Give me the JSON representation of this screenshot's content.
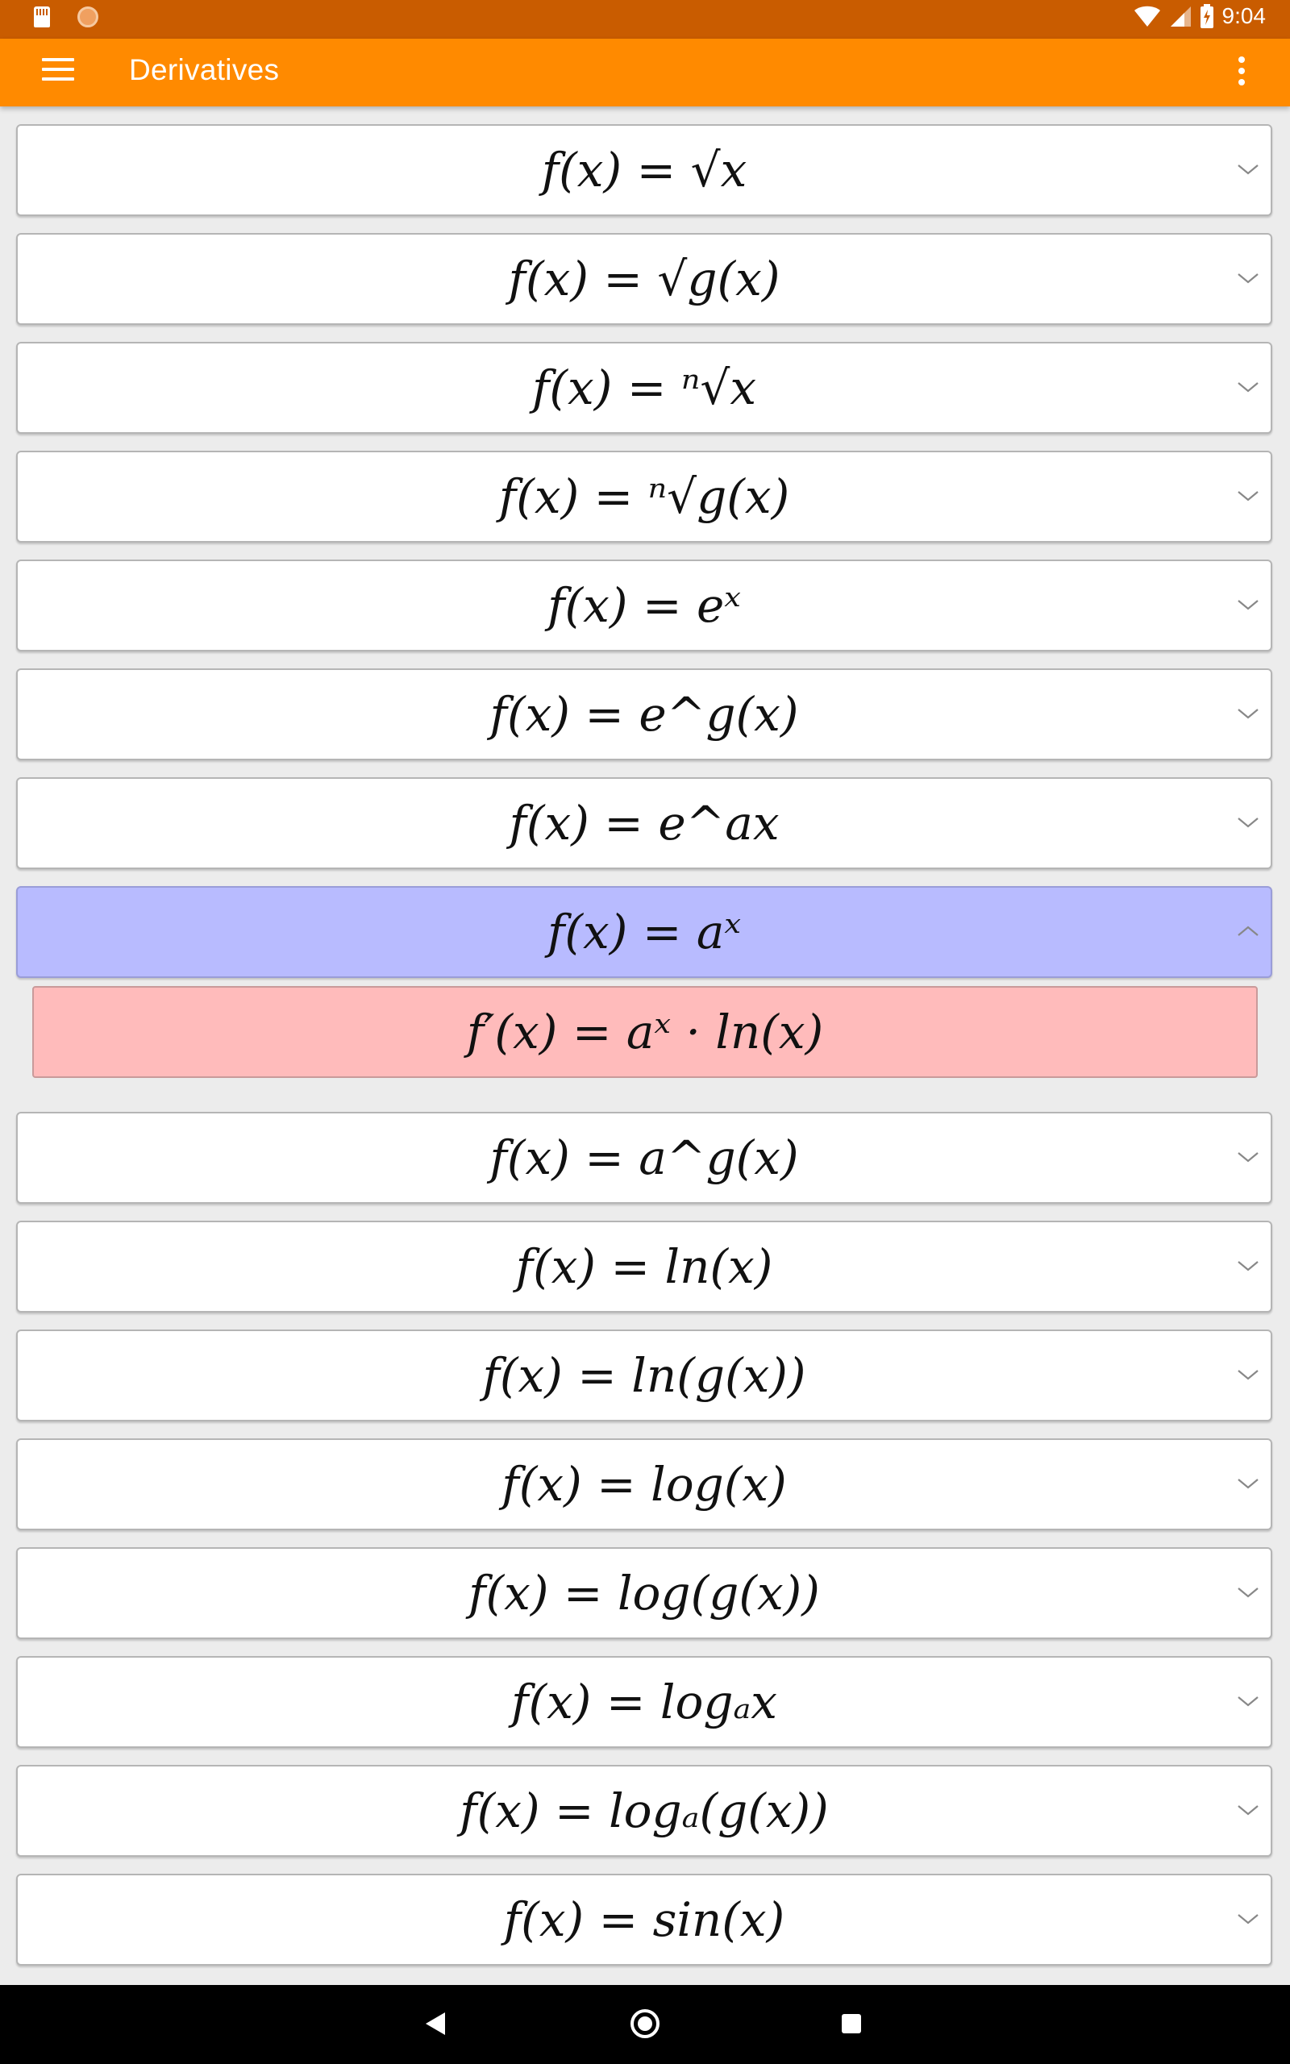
{
  "status_bar": {
    "time": "9:04",
    "icons": [
      "sd-card-icon",
      "record-icon",
      "wifi-icon",
      "signal-icon",
      "battery-charging-icon"
    ]
  },
  "app_bar": {
    "title": "Derivatives",
    "menu_icon": "menu-icon",
    "overflow_icon": "more-vert-icon"
  },
  "colors": {
    "status_bar": "#c95c00",
    "app_bar": "#ff8a00",
    "expanded_card": "#b8bbff",
    "answer_card": "#ffbbbb",
    "background": "#ececec"
  },
  "items": [
    {
      "formula": "f(x) = √x",
      "expanded": false
    },
    {
      "formula": "f(x) = √g(x)",
      "expanded": false
    },
    {
      "formula": "f(x) = ⁿ√x",
      "expanded": false
    },
    {
      "formula": "f(x) = ⁿ√g(x)",
      "expanded": false
    },
    {
      "formula": "f(x) = eˣ",
      "expanded": false
    },
    {
      "formula": "f(x) = e^g(x)",
      "expanded": false
    },
    {
      "formula": "f(x) = e^ax",
      "expanded": false
    },
    {
      "formula": "f(x) = aˣ",
      "expanded": true,
      "answer": "f′(x) = aˣ · ln(x)"
    },
    {
      "formula": "f(x) = a^g(x)",
      "expanded": false
    },
    {
      "formula": "f(x) = ln(x)",
      "expanded": false
    },
    {
      "formula": "f(x) = ln(g(x))",
      "expanded": false
    },
    {
      "formula": "f(x) = log(x)",
      "expanded": false
    },
    {
      "formula": "f(x) = log(g(x))",
      "expanded": false
    },
    {
      "formula": "f(x) = logₐx",
      "expanded": false
    },
    {
      "formula": "f(x) = logₐ(g(x))",
      "expanded": false
    },
    {
      "formula": "f(x) = sin(x)",
      "expanded": false
    }
  ],
  "nav_bar": {
    "icons": [
      "back-icon",
      "home-icon",
      "recents-icon"
    ]
  }
}
